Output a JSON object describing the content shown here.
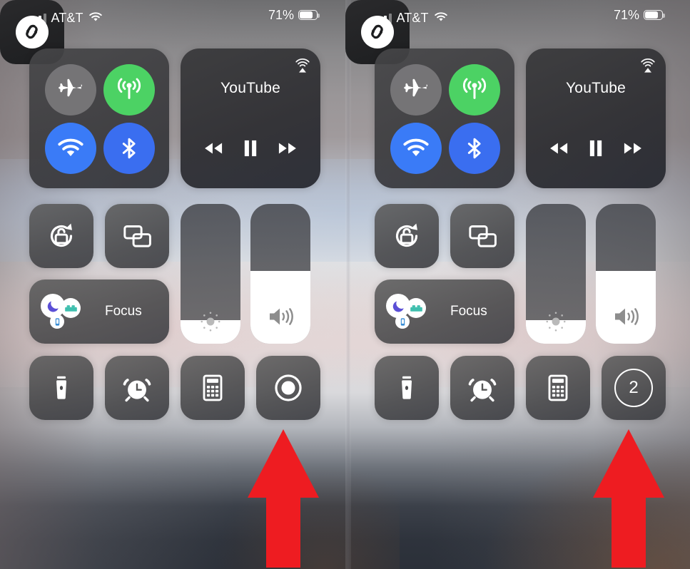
{
  "meta": {
    "screen_title": "iOS Control Center",
    "panel_count": 2,
    "description": "Two side-by-side iPhone Control Center screenshots; right panel shows screen-recording countdown"
  },
  "status_bar": {
    "carrier": "AT&T",
    "signal_bars_total": 4,
    "signal_bars_filled": 3,
    "wifi_icon": "wifi-icon",
    "battery_percent": "71%",
    "battery_level": 71,
    "battery_icon": "battery-icon"
  },
  "connectivity": {
    "airplane": {
      "label": "Airplane Mode",
      "icon": "airplane-icon",
      "state": "off",
      "color": "#787779"
    },
    "cellular": {
      "label": "Cellular Data",
      "icon": "cellular-icon",
      "state": "on",
      "color": "#4cd264"
    },
    "wifi": {
      "label": "Wi-Fi",
      "icon": "wifi-icon",
      "state": "on",
      "color": "#3a7bf7"
    },
    "bluetooth": {
      "label": "Bluetooth",
      "icon": "bluetooth-icon",
      "state": "on",
      "color": "#3a6ef0"
    }
  },
  "media": {
    "app_name": "YouTube",
    "airplay_icon": "airplay-icon",
    "rewind_icon": "rewind-icon",
    "playpause_icon": "pause-icon",
    "forward_icon": "fast-forward-icon",
    "playback_state": "playing"
  },
  "toggles": {
    "orientation_lock": {
      "label": "Portrait Orientation Lock",
      "icon": "rotation-lock-icon",
      "state": "off"
    },
    "screen_mirroring": {
      "label": "Screen Mirroring",
      "icon": "screen-mirroring-icon",
      "state": "off"
    }
  },
  "focus": {
    "label": "Focus",
    "icons": [
      "moon-icon",
      "bed-icon",
      "reading-icon"
    ],
    "moon_color": "#5b4fd6",
    "bed_color": "#3fbfae",
    "reading_color": "#3a8ed6"
  },
  "sliders": {
    "brightness": {
      "label": "Brightness",
      "icon": "brightness-icon",
      "value": 17
    },
    "volume": {
      "label": "Volume",
      "icon": "volume-icon",
      "value": 52
    }
  },
  "utilities": {
    "flashlight": {
      "label": "Flashlight",
      "icon": "flashlight-icon"
    },
    "timer": {
      "label": "Timer",
      "icon": "alarm-clock-icon"
    },
    "calculator": {
      "label": "Calculator",
      "icon": "calculator-icon"
    },
    "shazam": {
      "label": "Shazam",
      "icon": "shazam-icon"
    }
  },
  "screen_record": {
    "left_panel": {
      "label": "Screen Recording",
      "icon": "record-icon",
      "state": "idle",
      "countdown": ""
    },
    "right_panel": {
      "label": "Screen Recording",
      "icon": "countdown-icon",
      "state": "counting-down",
      "countdown": "2"
    }
  },
  "annotation": {
    "arrow": {
      "name": "red-arrow-up",
      "color": "#ee1c21",
      "direction": "up",
      "points_at": "screen-recording-button"
    }
  }
}
